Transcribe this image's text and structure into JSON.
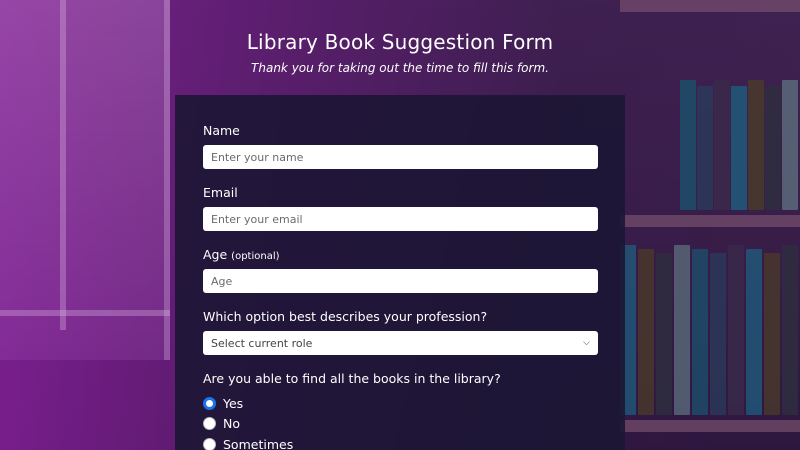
{
  "header": {
    "title": "Library Book Suggestion Form",
    "subtitle": "Thank you for taking out the time to fill this form."
  },
  "form": {
    "name": {
      "label": "Name",
      "placeholder": "Enter your name"
    },
    "email": {
      "label": "Email",
      "placeholder": "Enter your email"
    },
    "age": {
      "label": "Age",
      "optional": "(optional)",
      "placeholder": "Age"
    },
    "profession": {
      "label": "Which option best describes your profession?",
      "selected": "Select current role"
    },
    "books": {
      "question": "Are you able to find all the books in the library?",
      "options": [
        "Yes",
        "No",
        "Sometimes"
      ],
      "selected": "Yes"
    }
  },
  "colors": {
    "accent": "#1a73e8",
    "card": "#1c1634",
    "background": "#5a2d6a"
  },
  "icons": [
    "chevron-down-icon"
  ]
}
